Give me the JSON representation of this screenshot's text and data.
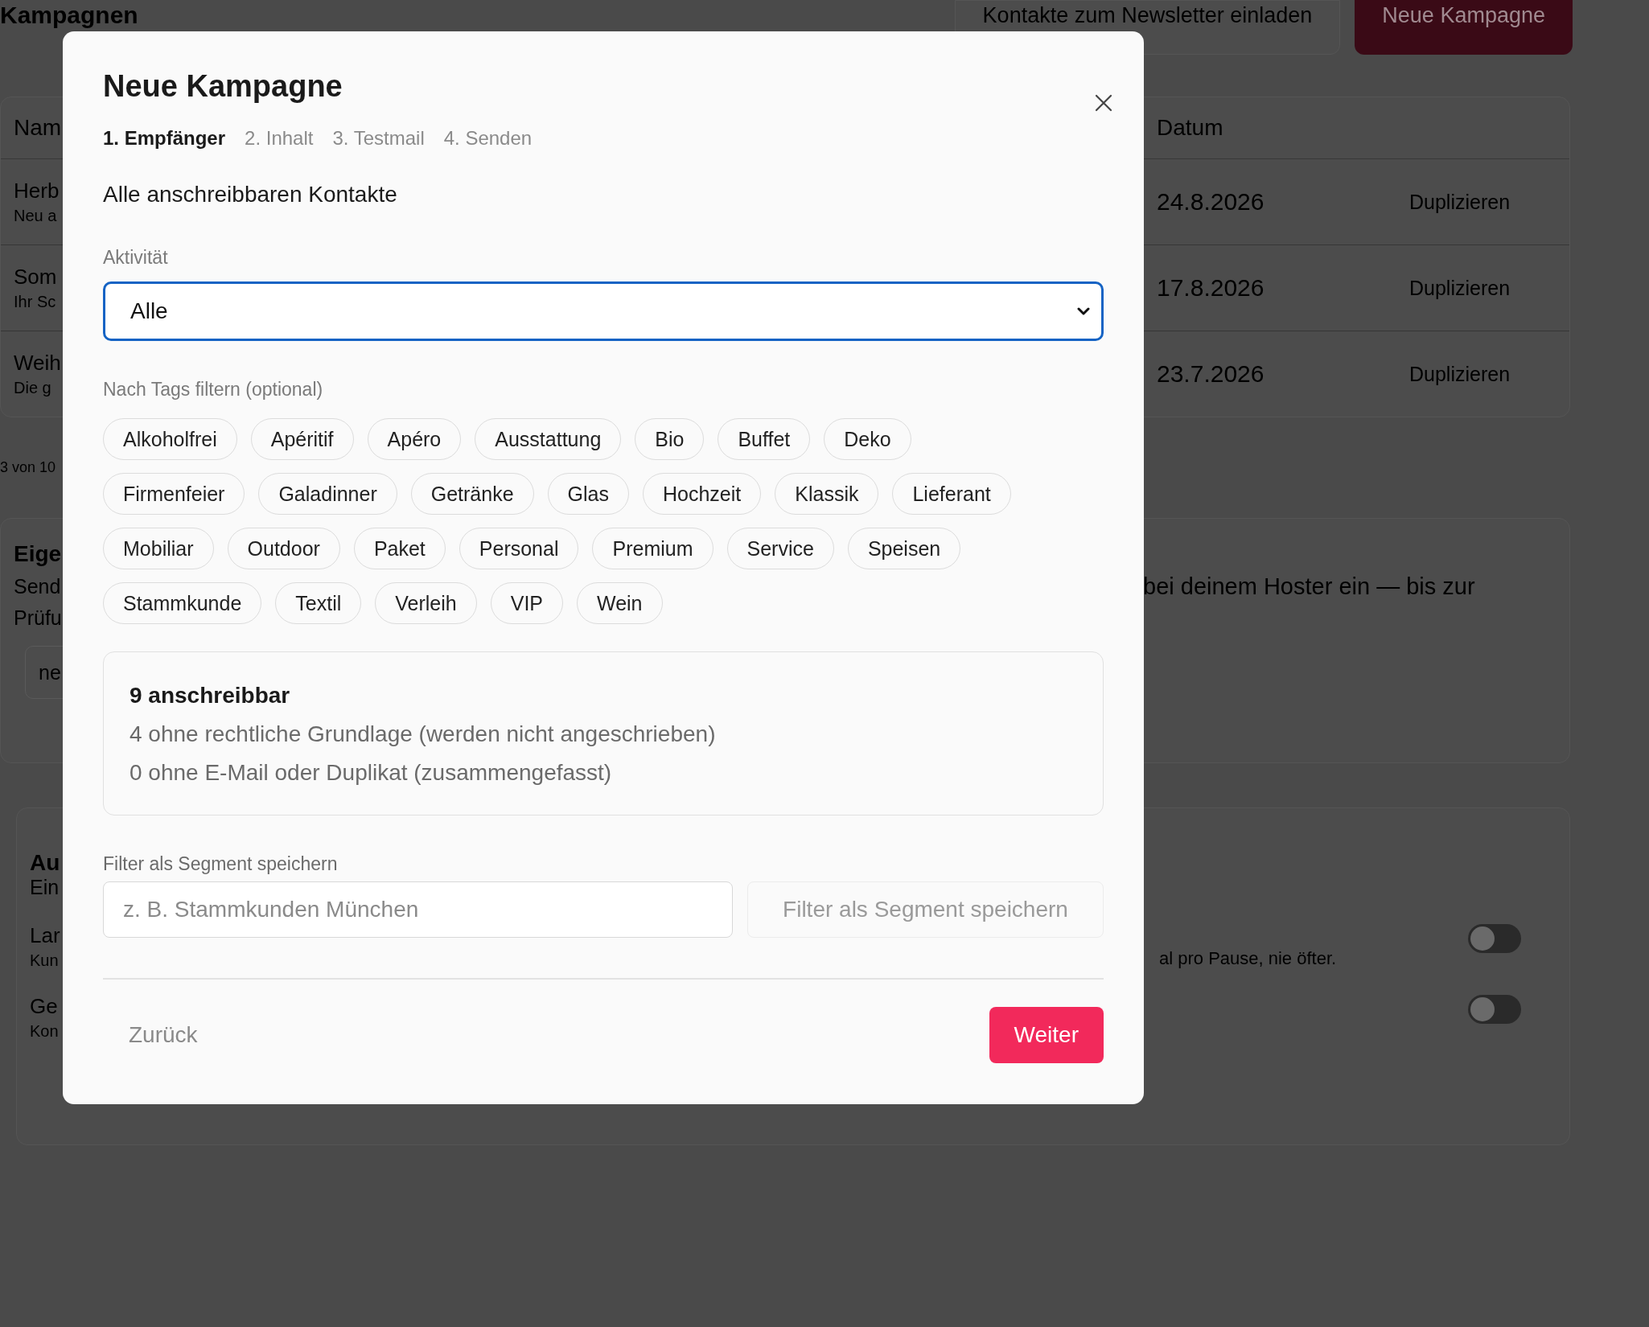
{
  "page": {
    "title": "Kampagnen",
    "actions": [
      {
        "label": "Kontakte zum Newsletter einladen",
        "kind": "secondary"
      },
      {
        "label": "Neue Kampagne",
        "kind": "primary"
      }
    ]
  },
  "table": {
    "columns": [
      "Nam",
      "Datum"
    ],
    "rows": [
      {
        "name": "Herb",
        "subtitle": "Neu a",
        "date": "24.8.2026",
        "action": "Duplizieren"
      },
      {
        "name": "Som",
        "subtitle": "Ihr Sc",
        "date": "17.8.2026",
        "action": "Duplizieren"
      },
      {
        "name": "Weih",
        "subtitle": "Die g",
        "date": "23.7.2026",
        "action": "Duplizieren"
      }
    ],
    "pagination": "3 von 10"
  },
  "sender_section": {
    "title": "Eige",
    "lines": [
      "Send",
      "Prüfu"
    ],
    "right_text": "bei deinem Hoster ein — bis zur",
    "field_value": "ne"
  },
  "automation_section": {
    "title": "Au",
    "subtitle": "Ein",
    "settings": [
      {
        "label": "Lar",
        "description": "Kun",
        "note": "al pro Pause, nie öfter.",
        "on": false
      },
      {
        "label": "Ge",
        "description": "Kon",
        "on": false
      }
    ]
  },
  "modal": {
    "title": "Neue Kampagne",
    "steps": [
      {
        "label": "1. Empfänger",
        "selected": true
      },
      {
        "label": "2. Inhalt",
        "selected": false
      },
      {
        "label": "3. Testmail",
        "selected": false
      },
      {
        "label": "4. Senden",
        "selected": false
      }
    ],
    "heading": "Alle anschreibbaren Kontakte",
    "activity": {
      "label": "Aktivität",
      "value": "Alle"
    },
    "tags": {
      "label": "Nach Tags filtern (optional)",
      "items": [
        {
          "label": "Alkoholfrei",
          "selected": false
        },
        {
          "label": "Apéritif",
          "selected": false
        },
        {
          "label": "Apéro",
          "selected": false
        },
        {
          "label": "Ausstattung",
          "selected": false
        },
        {
          "label": "Bio",
          "selected": false
        },
        {
          "label": "Buffet",
          "selected": false
        },
        {
          "label": "Deko",
          "selected": false
        },
        {
          "label": "Firmenfeier",
          "selected": false
        },
        {
          "label": "Galadinner",
          "selected": false
        },
        {
          "label": "Getränke",
          "selected": false
        },
        {
          "label": "Glas",
          "selected": false
        },
        {
          "label": "Hochzeit",
          "selected": false
        },
        {
          "label": "Klassik",
          "selected": false
        },
        {
          "label": "Lieferant",
          "selected": false
        },
        {
          "label": "Mobiliar",
          "selected": false
        },
        {
          "label": "Outdoor",
          "selected": false
        },
        {
          "label": "Paket",
          "selected": false
        },
        {
          "label": "Personal",
          "selected": false
        },
        {
          "label": "Premium",
          "selected": false
        },
        {
          "label": "Service",
          "selected": false
        },
        {
          "label": "Speisen",
          "selected": false
        },
        {
          "label": "Stammkunde",
          "selected": false
        },
        {
          "label": "Textil",
          "selected": false
        },
        {
          "label": "Verleih",
          "selected": false
        },
        {
          "label": "VIP",
          "selected": false
        },
        {
          "label": "Wein",
          "selected": false
        }
      ]
    },
    "summary": {
      "headline": "9 anschreibbar",
      "lines": [
        "4 ohne rechtliche Grundlage (werden nicht angeschrieben)",
        "0 ohne E-Mail oder Duplikat (zusammengefasst)"
      ]
    },
    "segment": {
      "label": "Filter als Segment speichern",
      "placeholder": "z. B. Stammkunden München",
      "button": "Filter als Segment speichern",
      "button_disabled": true
    },
    "back": "Zurück",
    "next": "Weiter"
  }
}
